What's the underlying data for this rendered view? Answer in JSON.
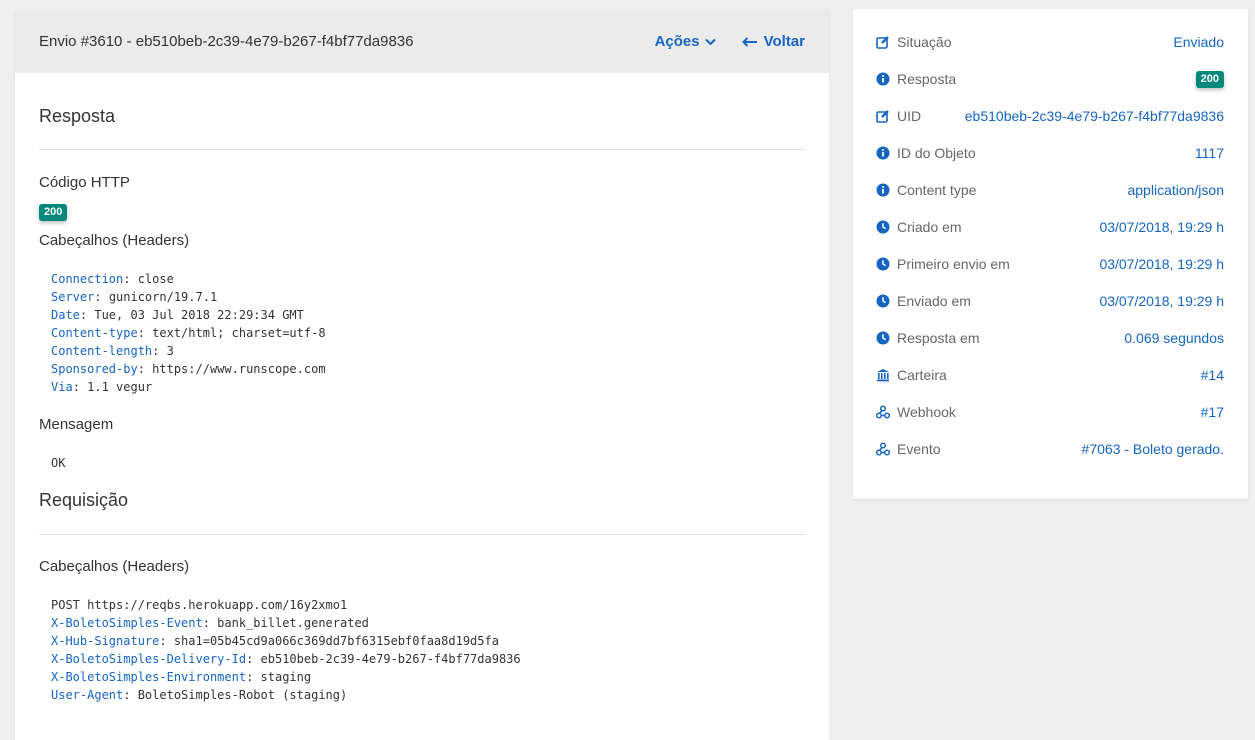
{
  "header": {
    "title": "Envio #3610 - eb510beb-2c39-4e79-b267-f4bf77da9836",
    "actions_label": "Ações",
    "back_label": "Voltar"
  },
  "response": {
    "section_title": "Resposta",
    "http_code_label": "Código HTTP",
    "http_code": "200",
    "headers_label": "Cabeçalhos (Headers)",
    "headers": [
      {
        "key": "Connection",
        "value": "close"
      },
      {
        "key": "Server",
        "value": "gunicorn/19.7.1"
      },
      {
        "key": "Date",
        "value": "Tue, 03 Jul 2018 22:29:34 GMT"
      },
      {
        "key": "Content-type",
        "value": "text/html; charset=utf-8"
      },
      {
        "key": "Content-length",
        "value": "3"
      },
      {
        "key": "Sponsored-by",
        "value": "https://www.runscope.com"
      },
      {
        "key": "Via",
        "value": "1.1 vegur"
      }
    ],
    "message_label": "Mensagem",
    "message": "OK"
  },
  "request": {
    "section_title": "Requisição",
    "headers_label": "Cabeçalhos (Headers)",
    "request_line": "POST https://reqbs.herokuapp.com/16y2xmo1",
    "headers": [
      {
        "key": "X-BoletoSimples-Event",
        "value": "bank_billet.generated"
      },
      {
        "key": "X-Hub-Signature",
        "value": "sha1=05b45cd9a066c369dd7bf6315ebf0faa8d19d5fa"
      },
      {
        "key": "X-BoletoSimples-Delivery-Id",
        "value": "eb510beb-2c39-4e79-b267-f4bf77da9836"
      },
      {
        "key": "X-BoletoSimples-Environment",
        "value": "staging"
      },
      {
        "key": "User-Agent",
        "value": "BoletoSimples-Robot (staging)"
      }
    ]
  },
  "sidebar": {
    "accent_color": "#1565c0",
    "badge_color": "#00897b",
    "rows": [
      {
        "icon": "edit-icon",
        "label": "Situação",
        "value": "Enviado",
        "type": "link"
      },
      {
        "icon": "info-icon",
        "label": "Resposta",
        "value": "200",
        "type": "badge"
      },
      {
        "icon": "edit-icon",
        "label": "UID",
        "value": "eb510beb-2c39-4e79-b267-f4bf77da9836",
        "type": "link"
      },
      {
        "icon": "info-icon",
        "label": "ID do Objeto",
        "value": "1117",
        "type": "link"
      },
      {
        "icon": "info-icon",
        "label": "Content type",
        "value": "application/json",
        "type": "link"
      },
      {
        "icon": "clock-icon",
        "label": "Criado em",
        "value": "03/07/2018, 19:29 h",
        "type": "link"
      },
      {
        "icon": "clock-icon",
        "label": "Primeiro envio em",
        "value": "03/07/2018, 19:29 h",
        "type": "link"
      },
      {
        "icon": "clock-icon",
        "label": "Enviado em",
        "value": "03/07/2018, 19:29 h",
        "type": "link"
      },
      {
        "icon": "clock-icon",
        "label": "Resposta em",
        "value": "0.069 segundos",
        "type": "link"
      },
      {
        "icon": "bank-icon",
        "label": "Carteira",
        "value": "#14",
        "type": "link"
      },
      {
        "icon": "webhook-icon",
        "label": "Webhook",
        "value": "#17",
        "type": "link"
      },
      {
        "icon": "webhook-icon",
        "label": "Evento",
        "value": "#7063 - Boleto gerado.",
        "type": "link"
      }
    ]
  }
}
